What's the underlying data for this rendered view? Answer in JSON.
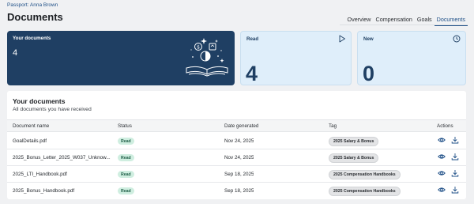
{
  "breadcrumb": "Passport: Anna Brown",
  "page_title": "Documents",
  "tabs": [
    {
      "label": "Overview"
    },
    {
      "label": "Compensation"
    },
    {
      "label": "Goals"
    },
    {
      "label": "Documents",
      "active": true
    }
  ],
  "cards": {
    "your_documents": {
      "label": "Your documents",
      "value": "4"
    },
    "read": {
      "label": "Read",
      "value": "4",
      "icon": "play-icon"
    },
    "new": {
      "label": "New",
      "value": "0",
      "icon": "clock-icon"
    }
  },
  "panel": {
    "title": "Your documents",
    "subtitle": "All documents you have received"
  },
  "table": {
    "headers": {
      "name": "Document name",
      "status": "Status",
      "date": "Date generated",
      "tag": "Tag",
      "actions": "Actions"
    },
    "rows": [
      {
        "name": "GoalDetails.pdf",
        "status": "Read",
        "date": "Nov 24, 2025",
        "tag": "2025 Salary & Bonus"
      },
      {
        "name": "2025_Bonus_Letter_2025_W037_Unknow...",
        "status": "Read",
        "date": "Nov 24, 2025",
        "tag": "2025 Salary & Bonus"
      },
      {
        "name": "2025_LTI_Handbook.pdf",
        "status": "Read",
        "date": "Sep 18, 2025",
        "tag": "2025 Compensation Handbooks"
      },
      {
        "name": "2025_Bonus_Handbook.pdf",
        "status": "Read",
        "date": "Sep 18, 2025",
        "tag": "2025 Compensation Handbooks"
      }
    ]
  },
  "colors": {
    "accent": "#1e4f87",
    "dark_card": "#1f3f63",
    "light_card": "#dfeefa",
    "read_badge": "#cfeee0",
    "tag_badge": "#e3e4e6"
  }
}
